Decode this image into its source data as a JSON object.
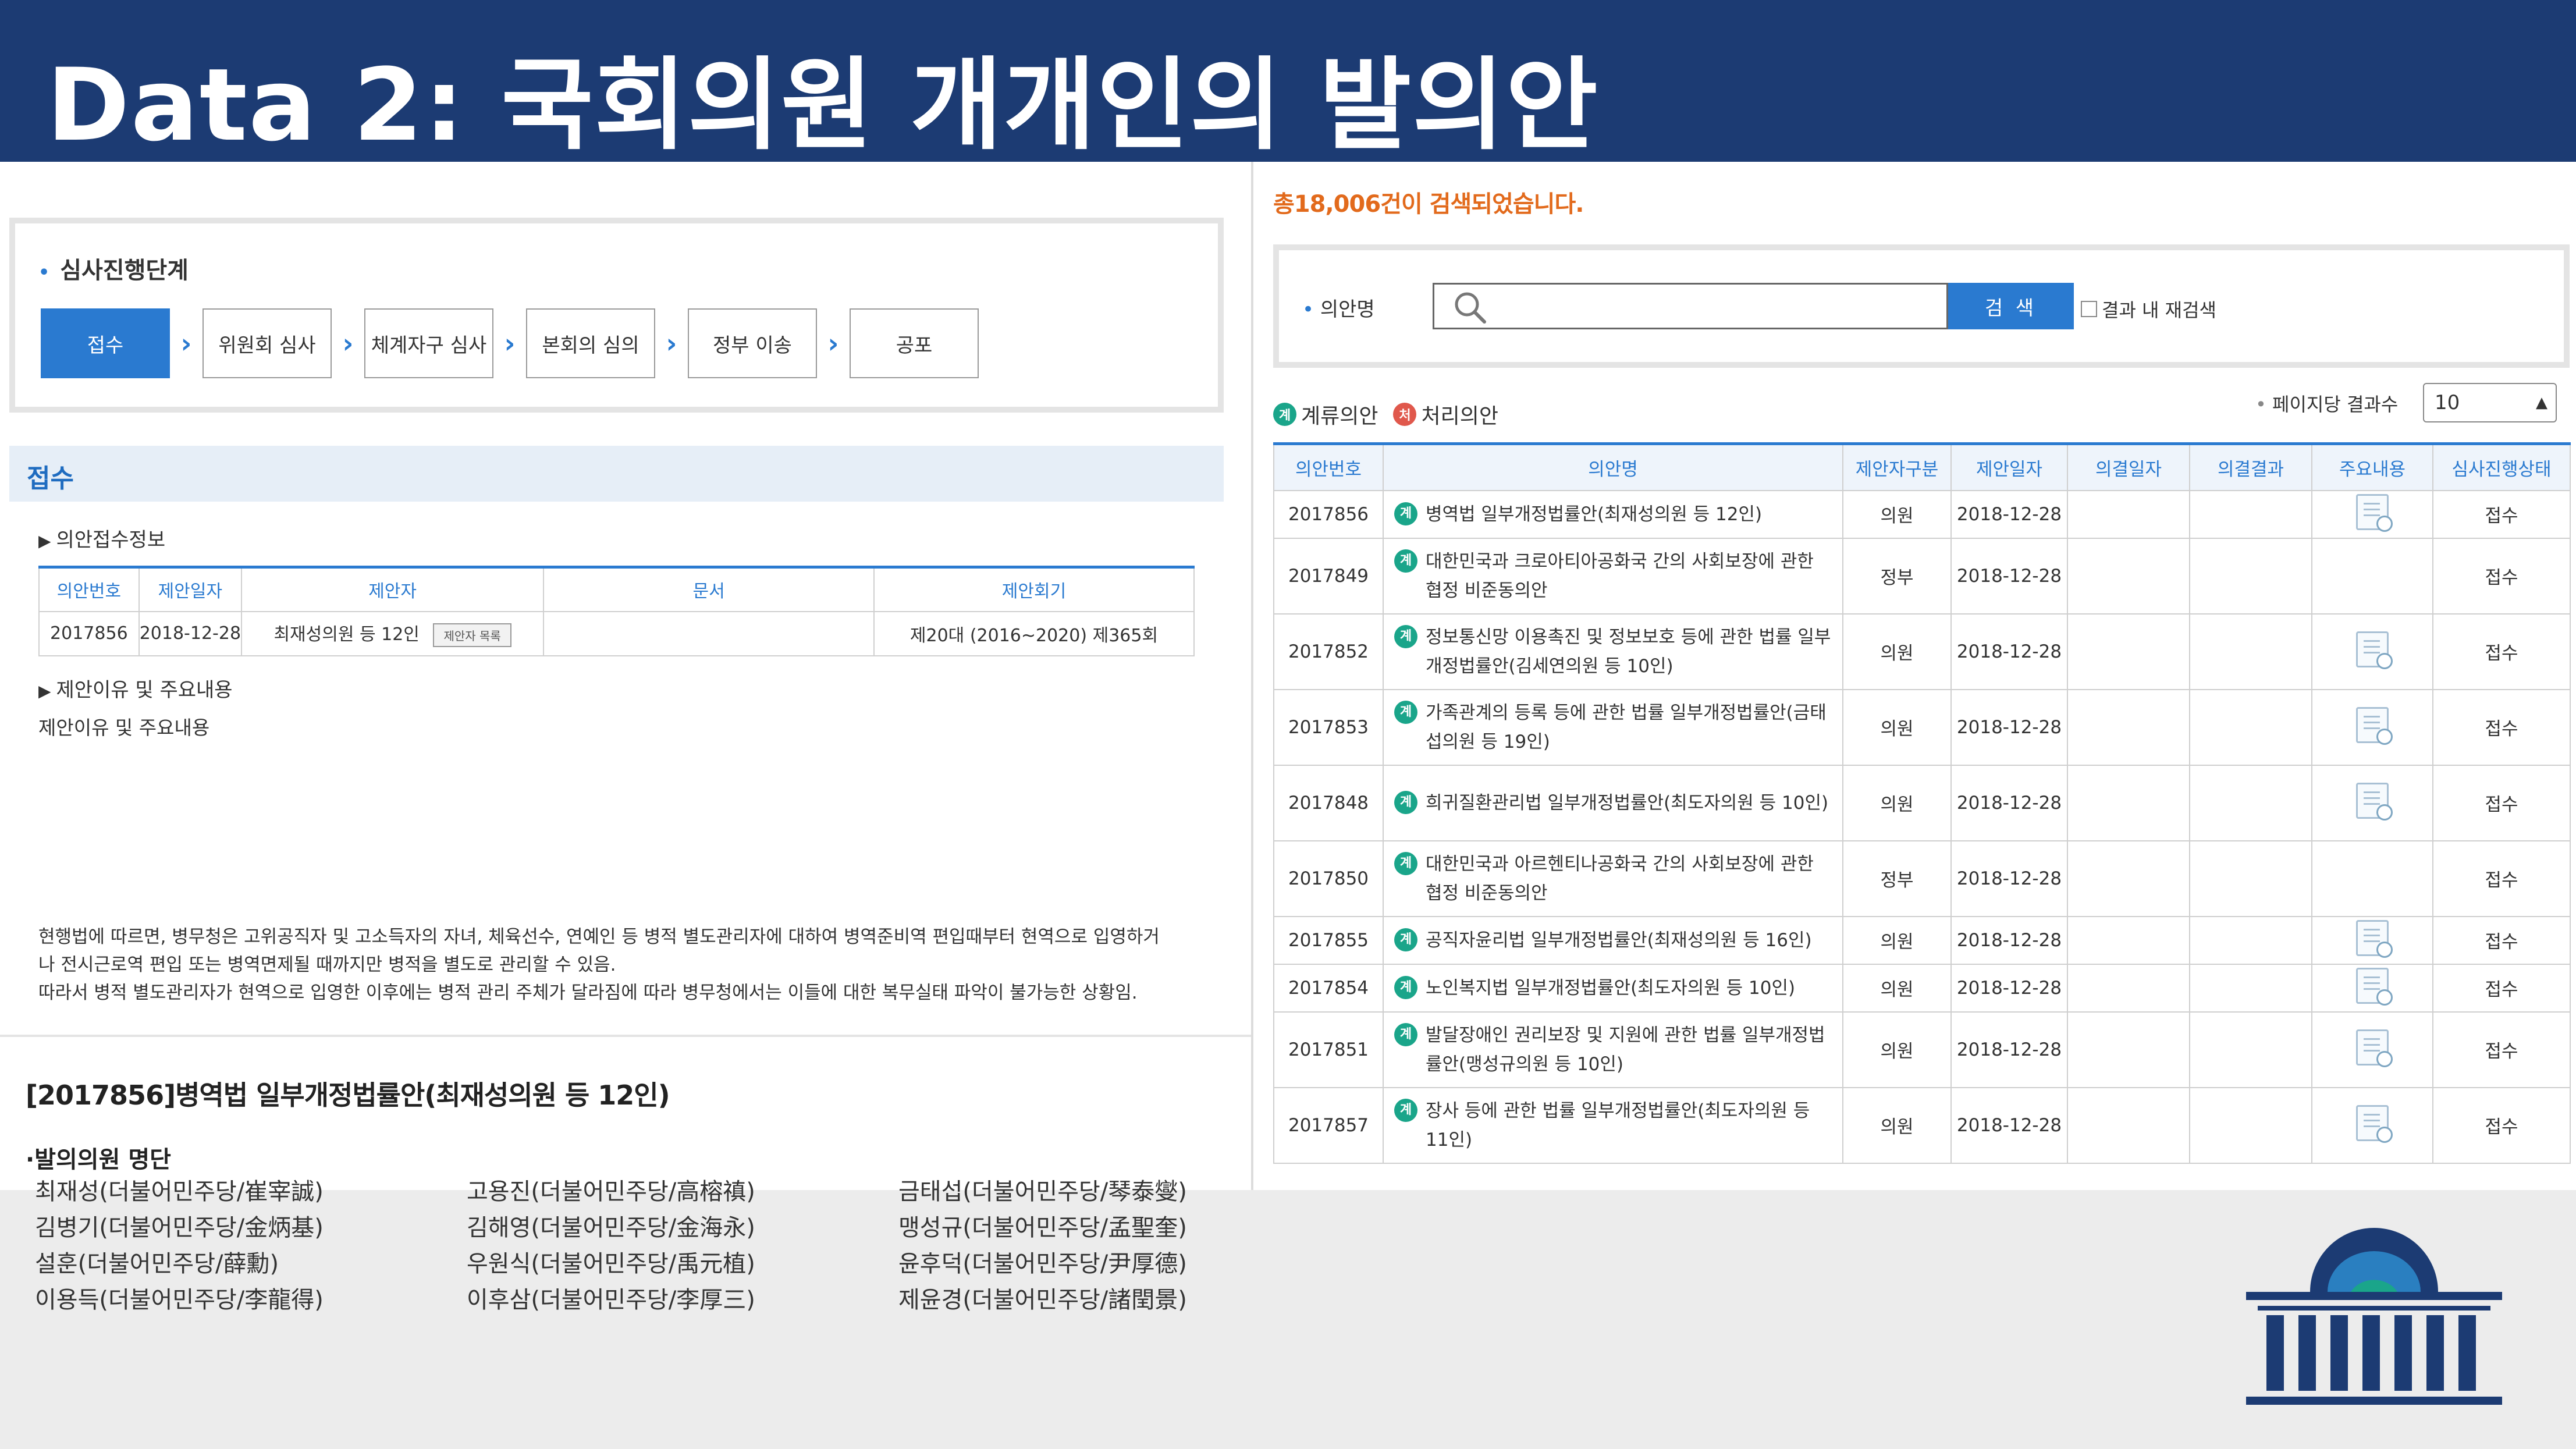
{
  "slide_title": "Data 2: 국회의원 개개인의 발의안",
  "left": {
    "stage_title": "심사진행단계",
    "stages": [
      "접수",
      "위원회 심사",
      "체계자구 심사",
      "본회의 심의",
      "정부 이송",
      "공포"
    ],
    "section_title": "접수",
    "receipt_info_label": "의안접수정보",
    "receipt_table": {
      "headers": [
        "의안번호",
        "제안일자",
        "제안자",
        "문서",
        "제안회기"
      ],
      "row": {
        "bill_no": "2017856",
        "date": "2018-12-28",
        "proposer": "최재성의원 등 12인",
        "proposer_button": "제안자 목록",
        "doc": "",
        "session": "제20대 (2016~2020) 제365회"
      }
    },
    "reason_label": "제안이유 및 주요내용",
    "reason_sublabel": "제안이유 및 주요내용",
    "reason_text": [
      "현행법에 따르면, 병무청은 고위공직자 및 고소득자의 자녀, 체육선수, 연예인 등 병적 별도관리자에 대하여 병역준비역 편입때부터 현역으로 입영하거",
      "나 전시근로역 편입 또는 병역면제될 때까지만 병적을 별도로 관리할 수 있음.",
      "따라서 병적 별도관리자가 현역으로 입영한 이후에는 병적 관리 주체가 달라짐에 따라 병무청에서는 이들에 대한 복무실태 파악이 불가능한 상황임."
    ],
    "bill_title": "[2017856]병역법 일부개정법률안(최재성의원 등 12인)",
    "proposers_head": "·발의의원 명단",
    "proposers": [
      "최재성(더불어민주당/崔宰誠)",
      "고용진(더불어민주당/高榕禛)",
      "금태섭(더불어민주당/琴泰燮)",
      "김병기(더불어민주당/金炳基)",
      "김해영(더불어민주당/金海永)",
      "맹성규(더불어민주당/孟聖奎)",
      "설훈(더불어민주당/薛勳)",
      "우원식(더불어민주당/禹元植)",
      "윤후덕(더불어민주당/尹厚德)",
      "이용득(더불어민주당/李龍得)",
      "이후삼(더불어민주당/李厚三)",
      "제윤경(더불어민주당/諸閏景)"
    ]
  },
  "right": {
    "total_text": "총18,006건이 검색되었습니다.",
    "search_label": "의안명",
    "search_value": "",
    "search_button": "검 색",
    "recheck_label": "결과 내 재검색",
    "legend_pending": "계류의안",
    "legend_pending_icon": "계",
    "legend_done": "처리의안",
    "legend_done_icon": "처",
    "page_size_label": "페이지당 결과수",
    "page_size_value": "10",
    "table_headers": [
      "의안번호",
      "의안명",
      "제안자구분",
      "제안일자",
      "의결일자",
      "의결결과",
      "주요내용",
      "심사진행상태"
    ],
    "rows": [
      {
        "no": "2017856",
        "name": "병역법 일부개정법률안(최재성의원 등 12인)",
        "proposer": "의원",
        "date": "2018-12-28",
        "vote_date": "",
        "result": "",
        "doc": true,
        "status": "접수",
        "tall": false
      },
      {
        "no": "2017849",
        "name": "대한민국과 크로아티아공화국 간의 사회보장에 관한 협정 비준동의안",
        "proposer": "정부",
        "date": "2018-12-28",
        "vote_date": "",
        "result": "",
        "doc": false,
        "status": "접수",
        "tall": true
      },
      {
        "no": "2017852",
        "name": "정보통신망 이용촉진 및 정보보호 등에 관한 법률 일부개정법률안(김세연의원 등 10인)",
        "proposer": "의원",
        "date": "2018-12-28",
        "vote_date": "",
        "result": "",
        "doc": true,
        "status": "접수",
        "tall": true
      },
      {
        "no": "2017853",
        "name": "가족관계의 등록 등에 관한 법률 일부개정법률안(금태섭의원 등 19인)",
        "proposer": "의원",
        "date": "2018-12-28",
        "vote_date": "",
        "result": "",
        "doc": true,
        "status": "접수",
        "tall": true
      },
      {
        "no": "2017848",
        "name": "희귀질환관리법 일부개정법률안(최도자의원 등 10인)",
        "proposer": "의원",
        "date": "2018-12-28",
        "vote_date": "",
        "result": "",
        "doc": true,
        "status": "접수",
        "tall": true
      },
      {
        "no": "2017850",
        "name": "대한민국과 아르헨티나공화국 간의 사회보장에 관한 협정 비준동의안",
        "proposer": "정부",
        "date": "2018-12-28",
        "vote_date": "",
        "result": "",
        "doc": false,
        "status": "접수",
        "tall": true
      },
      {
        "no": "2017855",
        "name": "공직자윤리법 일부개정법률안(최재성의원 등 16인)",
        "proposer": "의원",
        "date": "2018-12-28",
        "vote_date": "",
        "result": "",
        "doc": true,
        "status": "접수",
        "tall": false
      },
      {
        "no": "2017854",
        "name": "노인복지법 일부개정법률안(최도자의원 등 10인)",
        "proposer": "의원",
        "date": "2018-12-28",
        "vote_date": "",
        "result": "",
        "doc": true,
        "status": "접수",
        "tall": false
      },
      {
        "no": "2017851",
        "name": "발달장애인 권리보장 및 지원에 관한 법률 일부개정법률안(맹성규의원 등 10인)",
        "proposer": "의원",
        "date": "2018-12-28",
        "vote_date": "",
        "result": "",
        "doc": true,
        "status": "접수",
        "tall": true
      },
      {
        "no": "2017857",
        "name": "장사 등에 관한 법률 일부개정법률안(최도자의원 등 11인)",
        "proposer": "의원",
        "date": "2018-12-28",
        "vote_date": "",
        "result": "",
        "doc": true,
        "status": "접수",
        "tall": true
      }
    ]
  },
  "colors": {
    "title_bar": "#1c3b73",
    "accent_blue": "#2a7ad0",
    "total_orange": "#e26a1c",
    "pending_green": "#1aa58a",
    "done_red": "#e0584c"
  }
}
